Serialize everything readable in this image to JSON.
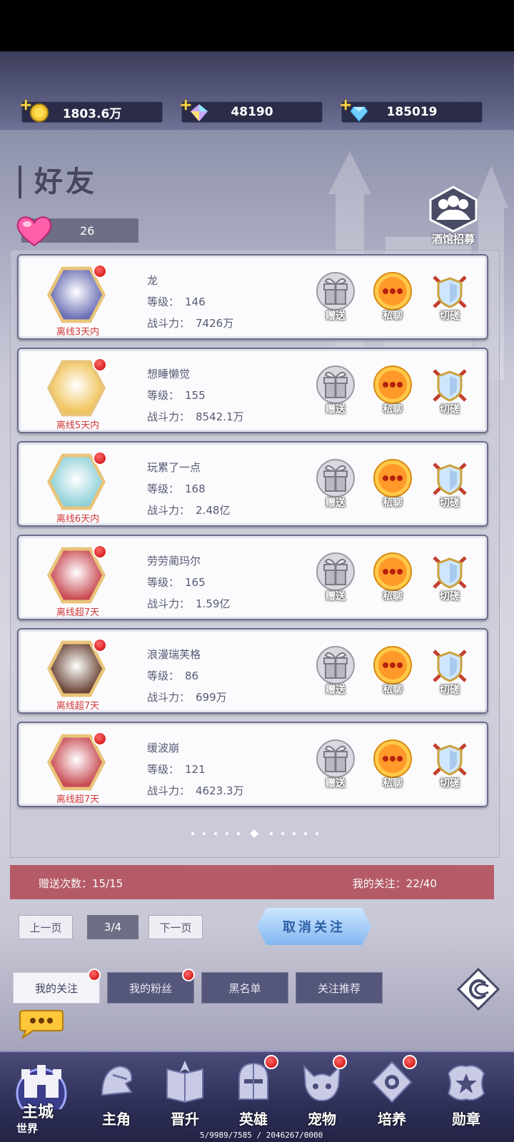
{
  "resources": [
    {
      "icon": "gold-coin-icon",
      "value": "1803.6万"
    },
    {
      "icon": "rainbow-crystal-icon",
      "value": "48190"
    },
    {
      "icon": "blue-diamond-icon",
      "value": "185019"
    }
  ],
  "page_title": "好友",
  "hearts": "26",
  "tavern_label": "酒馆招募",
  "friends": [
    {
      "name": "龙",
      "level_label": "等级：",
      "level": "146",
      "power_label": "战斗力：",
      "power": "7426万",
      "status": "离线3天内",
      "avatar_color": "#6a6fb5"
    },
    {
      "name": "想睡懒觉",
      "level_label": "等级：",
      "level": "155",
      "power_label": "战斗力：",
      "power": "8542.1万",
      "status": "离线5天内",
      "avatar_color": "#f0c45a"
    },
    {
      "name": "玩累了一点",
      "level_label": "等级：",
      "level": "168",
      "power_label": "战斗力：",
      "power": "2.48亿",
      "status": "离线6天内",
      "avatar_color": "#8fd0d8"
    },
    {
      "name": "劳劳蔺玛尔",
      "level_label": "等级：",
      "level": "165",
      "power_label": "战斗力：",
      "power": "1.59亿",
      "status": "离线超7天",
      "avatar_color": "#c84a52"
    },
    {
      "name": "浪漫瑞芙格",
      "level_label": "等级：",
      "level": "86",
      "power_label": "战斗力：",
      "power": "699万",
      "status": "离线超7天",
      "avatar_color": "#6b4636"
    },
    {
      "name": "缓波崩",
      "level_label": "等级：",
      "level": "121",
      "power_label": "战斗力：",
      "power": "4623.3万",
      "status": "离线超7天",
      "avatar_color": "#c84a52"
    }
  ],
  "actions": {
    "gift": "赠送",
    "chat": "私聊",
    "duel": "切磋"
  },
  "stats": {
    "gift_count": "赠送次数：15/15",
    "following": "我的关注：22/40"
  },
  "pagination": {
    "prev": "上一页",
    "page": "3/4",
    "next": "下一页"
  },
  "unfollow_label": "取消关注",
  "tabs": [
    {
      "label": "我的关注",
      "active": true,
      "dot": true
    },
    {
      "label": "我的粉丝",
      "active": false,
      "dot": true
    },
    {
      "label": "黑名单",
      "active": false,
      "dot": false
    },
    {
      "label": "关注推荐",
      "active": false,
      "dot": false
    }
  ],
  "nav": [
    {
      "label": "主城",
      "sub": "世界"
    },
    {
      "label": "主角"
    },
    {
      "label": "晋升"
    },
    {
      "label": "英雄"
    },
    {
      "label": "宠物"
    },
    {
      "label": "培养"
    },
    {
      "label": "勋章"
    }
  ],
  "debug_text": "5/9989/7585 / 2046267/0000"
}
